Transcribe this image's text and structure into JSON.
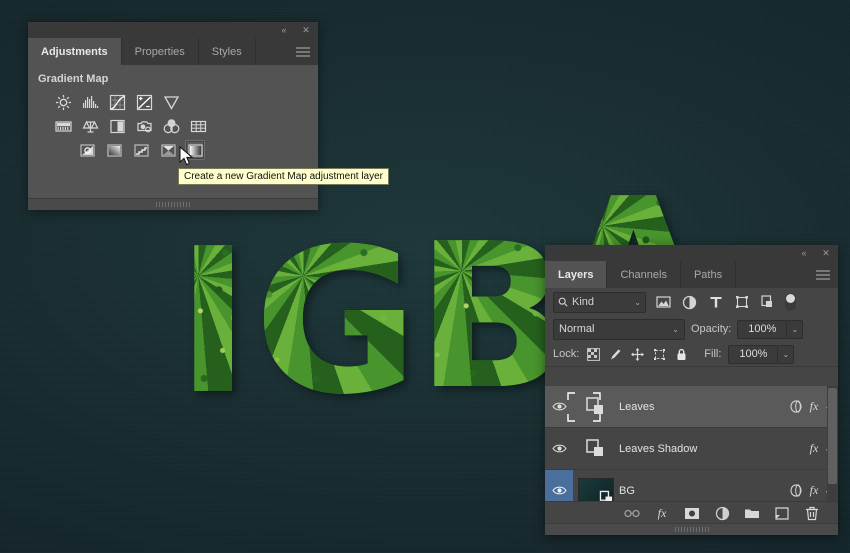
{
  "canvas": {
    "background_color": "#14272b",
    "artwork_text": "IGBA",
    "artwork_description": "leaf-textured 3D lettering"
  },
  "adjustments_panel": {
    "title": "Adjustments",
    "tabs": [
      {
        "label": "Adjustments",
        "active": true
      },
      {
        "label": "Properties",
        "active": false
      },
      {
        "label": "Styles",
        "active": false
      }
    ],
    "heading": "Gradient Map",
    "titlebar_icons": {
      "collapse": "«",
      "close": "✕"
    },
    "menu_icon": "hamburger-menu-icon",
    "icon_rows": [
      [
        {
          "name": "brightness-contrast-icon",
          "label": "Brightness/Contrast"
        },
        {
          "name": "levels-icon",
          "label": "Levels"
        },
        {
          "name": "curves-icon",
          "label": "Curves"
        },
        {
          "name": "exposure-icon",
          "label": "Exposure"
        },
        {
          "name": "vibrance-icon",
          "label": "Vibrance"
        }
      ],
      [
        {
          "name": "hue-saturation-icon",
          "label": "Hue/Saturation"
        },
        {
          "name": "color-balance-icon",
          "label": "Color Balance"
        },
        {
          "name": "black-white-icon",
          "label": "Black & White"
        },
        {
          "name": "photo-filter-icon",
          "label": "Photo Filter"
        },
        {
          "name": "channel-mixer-icon",
          "label": "Channel Mixer"
        },
        {
          "name": "color-lookup-icon",
          "label": "Color Lookup"
        }
      ],
      [
        {
          "name": "invert-icon",
          "label": "Invert"
        },
        {
          "name": "posterize-icon",
          "label": "Posterize"
        },
        {
          "name": "threshold-icon",
          "label": "Threshold"
        },
        {
          "name": "selective-color-icon",
          "label": "Selective Color"
        },
        {
          "name": "gradient-map-icon",
          "label": "Gradient Map",
          "hovered": true
        }
      ]
    ],
    "tooltip": "Create a new Gradient Map adjustment layer"
  },
  "layers_panel": {
    "tabs": [
      {
        "label": "Layers",
        "active": true
      },
      {
        "label": "Channels",
        "active": false
      },
      {
        "label": "Paths",
        "active": false
      }
    ],
    "titlebar_icons": {
      "collapse": "«",
      "close": "✕"
    },
    "menu_icon": "hamburger-menu-icon",
    "filter": {
      "kind_label": "Kind",
      "search_icon": "search-icon",
      "chevron": "⌄",
      "filter_icons": [
        {
          "name": "filter-pixel-icon"
        },
        {
          "name": "filter-adjustment-icon"
        },
        {
          "name": "filter-type-icon"
        },
        {
          "name": "filter-shape-icon"
        },
        {
          "name": "filter-smart-object-icon"
        }
      ],
      "toggle_name": "filter-enable-toggle"
    },
    "blend": {
      "mode": "Normal",
      "mode_chevron": "⌄",
      "opacity_label": "Opacity:",
      "opacity_value": "100%",
      "opacity_chevron": "⌄"
    },
    "lock": {
      "label": "Lock:",
      "icons": [
        {
          "name": "lock-transparent-pixels-icon"
        },
        {
          "name": "lock-image-pixels-icon"
        },
        {
          "name": "lock-position-icon"
        },
        {
          "name": "lock-artboard-nesting-icon"
        },
        {
          "name": "lock-all-icon"
        }
      ],
      "fill_label": "Fill:",
      "fill_value": "100%",
      "fill_chevron": "⌄"
    },
    "layers": [
      {
        "name": "Leaves",
        "visible": true,
        "selected": true,
        "active": false,
        "thumb_type": "smart-object",
        "has_effects": true,
        "effects_badge": "fx",
        "styles_icon": "layer-style-icon",
        "expand_chevron": "⌄"
      },
      {
        "name": "Leaves Shadow",
        "visible": true,
        "selected": false,
        "active": false,
        "thumb_type": "smart-object",
        "has_effects": true,
        "effects_badge": "fx",
        "styles_icon": "",
        "expand_chevron": "⌄"
      },
      {
        "name": "BG",
        "visible": true,
        "selected": false,
        "active": true,
        "thumb_type": "image",
        "thumb_color": "#17373a",
        "has_effects": true,
        "effects_badge": "fx",
        "styles_icon": "layer-style-icon",
        "expand_chevron": "⌄"
      }
    ],
    "toolbar_icons": [
      {
        "name": "link-layers-icon"
      },
      {
        "name": "add-layer-style-icon",
        "label": "fx"
      },
      {
        "name": "add-layer-mask-icon"
      },
      {
        "name": "new-adjustment-layer-icon"
      },
      {
        "name": "new-group-icon"
      },
      {
        "name": "new-layer-icon"
      },
      {
        "name": "delete-layer-icon"
      }
    ]
  }
}
